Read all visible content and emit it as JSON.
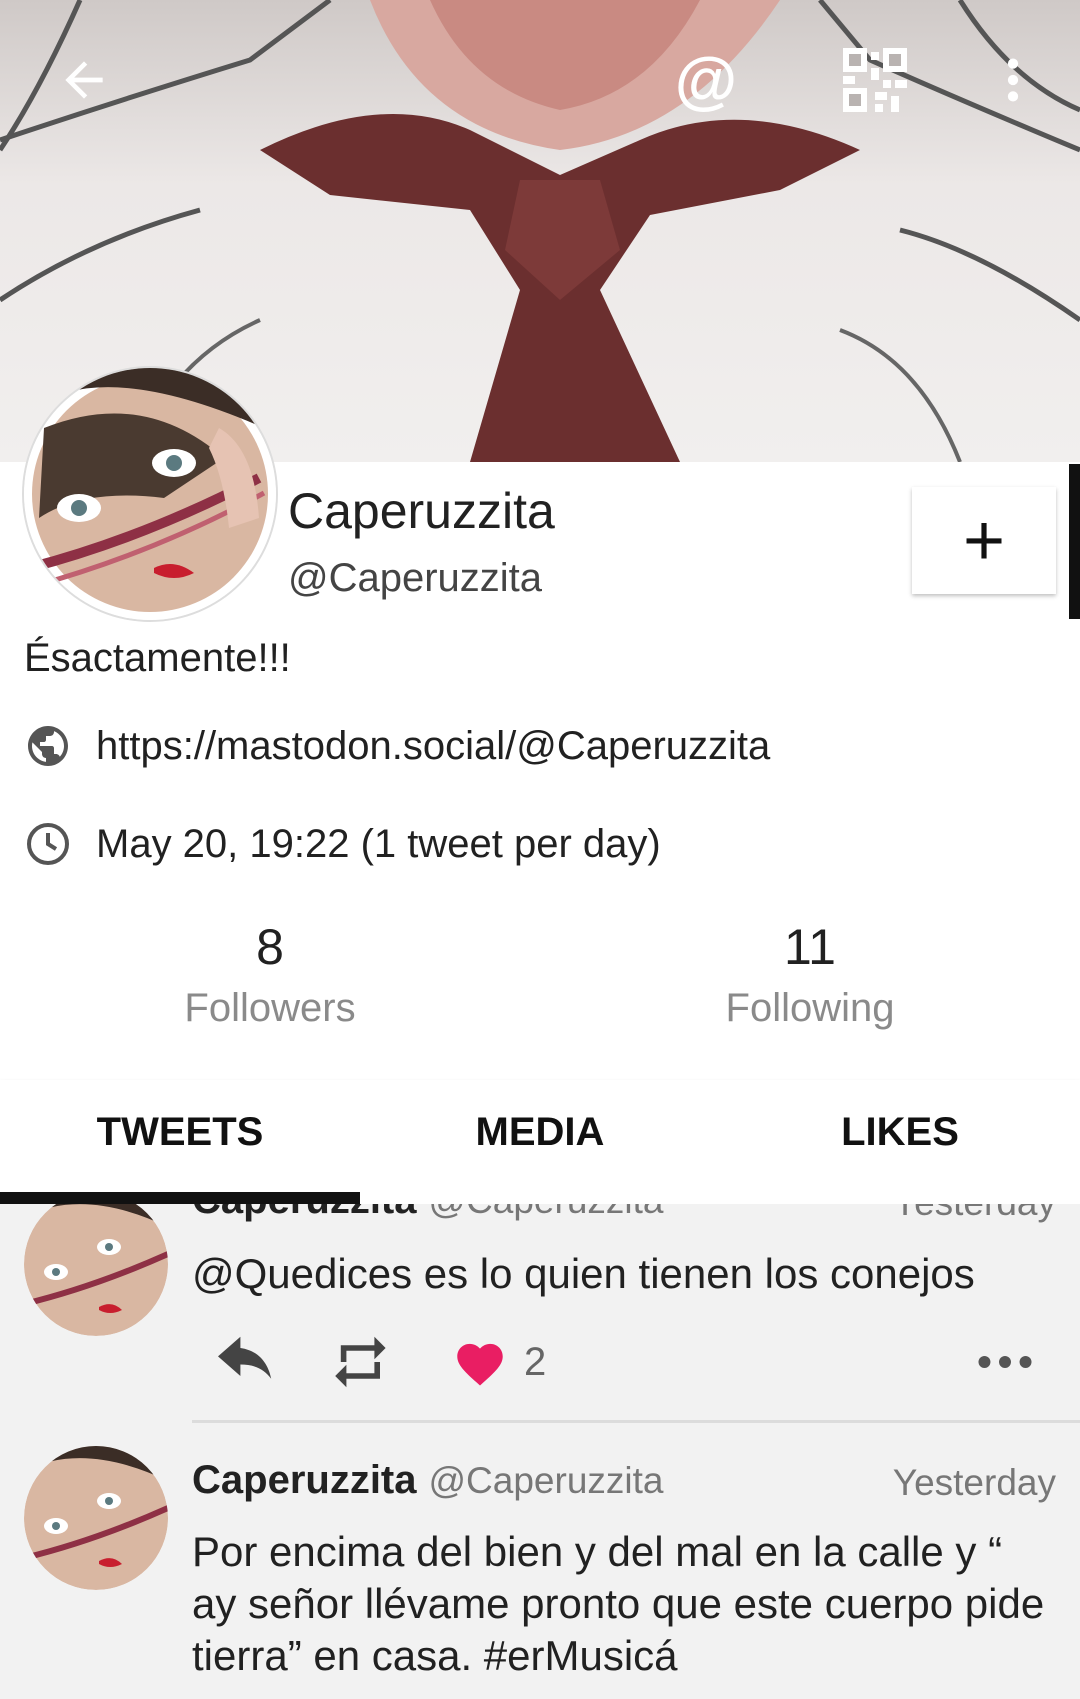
{
  "header": {
    "back_icon": "arrow-back-icon",
    "mention_label": "@",
    "qr_icon": "qr-code-icon",
    "overflow_icon": "more-vert-icon"
  },
  "profile": {
    "display_name": "Caperuzzita",
    "handle": "@Caperuzzita",
    "bio": "Ésactamente!!!",
    "url": "https://mastodon.social/@Caperuzzita",
    "last_active": "May 20, 19:22 (1 tweet per day)",
    "follow_label": "+"
  },
  "stats": {
    "followers_count": "8",
    "followers_label": "Followers",
    "following_count": "11",
    "following_label": "Following"
  },
  "tabs": [
    {
      "label": "TWEETS",
      "selected": true
    },
    {
      "label": "MEDIA",
      "selected": false
    },
    {
      "label": "LIKES",
      "selected": false
    }
  ],
  "posts": [
    {
      "name": "Caperuzzita",
      "handle": "@Caperuzzita",
      "time": "Yesterday",
      "text": "@Quedices es lo quien tienen los conejos",
      "likes": "2"
    },
    {
      "name": "Caperuzzita",
      "handle": "@Caperuzzita",
      "time": "Yesterday",
      "text": "Por encima del bien y del mal en la calle y “ ay señor llévame pronto que este cuerpo pide tierra” en casa. #erMusicá"
    }
  ],
  "colors": {
    "like": "#e91e63",
    "tab_indicator": "#111111",
    "secondary_text": "#8a8a8a"
  }
}
